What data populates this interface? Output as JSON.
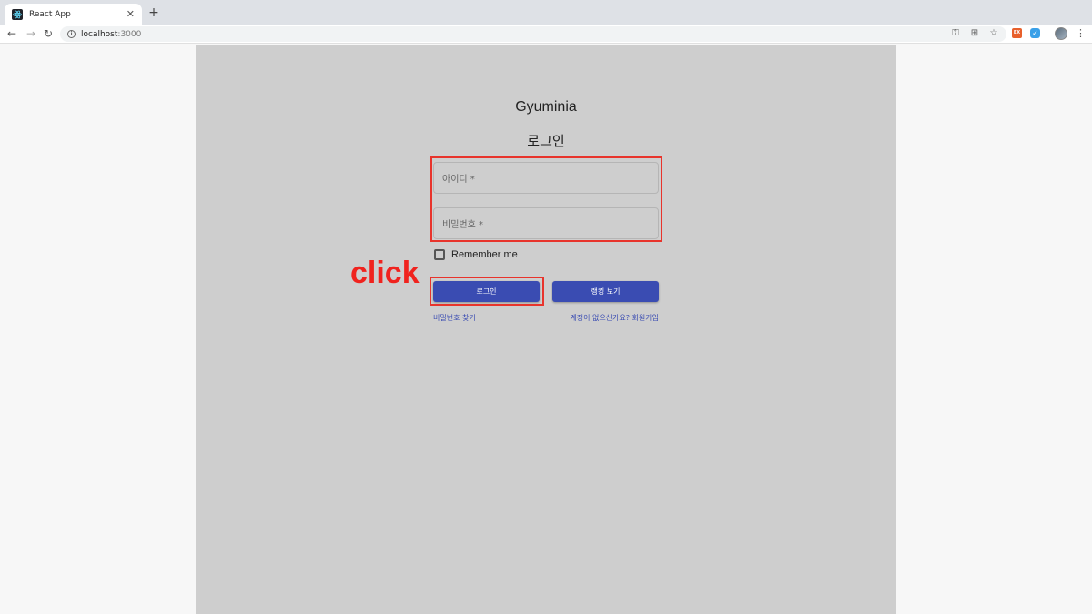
{
  "browser": {
    "tab_title": "React App",
    "url_host": "localhost",
    "url_port": ":3000"
  },
  "page": {
    "brand": "Gyuminia",
    "heading": "로그인",
    "username_label": "아이디 *",
    "password_label": "비밀번호 *",
    "remember_label": "Remember me",
    "remember_checked": false,
    "login_button": "로그인",
    "ranking_button": "랭킹 보기",
    "forgot_link": "비밀번호 찾기",
    "signup_link": "계정이 없으신가요? 회원가입"
  },
  "annotation": {
    "click_text": "click",
    "color": "#f0231e"
  },
  "colors": {
    "primary": "#3a4cb2",
    "panel": "#cecece"
  }
}
